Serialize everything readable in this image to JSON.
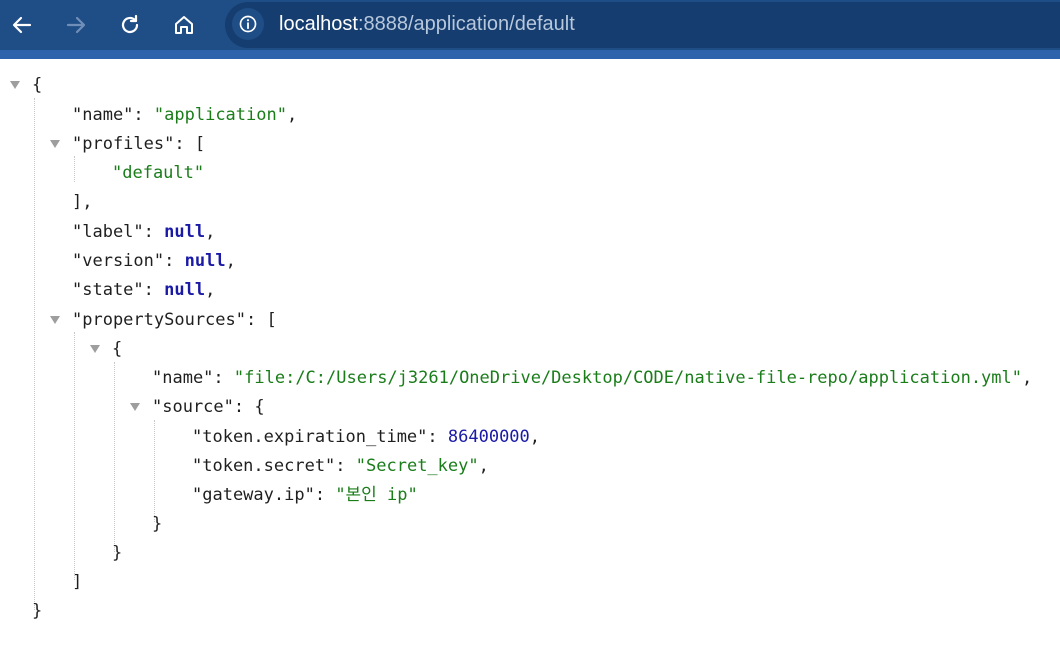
{
  "browser": {
    "url_host": "localhost",
    "url_path": ":8888/application/default"
  },
  "json": {
    "open_brace": "{",
    "close_brace": "}",
    "name_key": "\"name\"",
    "name_value": "\"application\"",
    "profiles_key": "\"profiles\"",
    "profiles_item": "\"default\"",
    "label_key": "\"label\"",
    "version_key": "\"version\"",
    "state_key": "\"state\"",
    "null_value": "null",
    "property_sources_key": "\"propertySources\"",
    "ps_name_key": "\"name\"",
    "ps_name_value": "\"file:/C:/Users/j3261/OneDrive/Desktop/CODE/native-file-repo/application.yml\"",
    "source_key": "\"source\"",
    "token_exp_key": "\"token.expiration_time\"",
    "token_exp_value": "86400000",
    "token_secret_key": "\"token.secret\"",
    "token_secret_value": "\"Secret_key\"",
    "gateway_key": "\"gateway.ip\"",
    "gateway_value": "\"본인 ip\""
  }
}
